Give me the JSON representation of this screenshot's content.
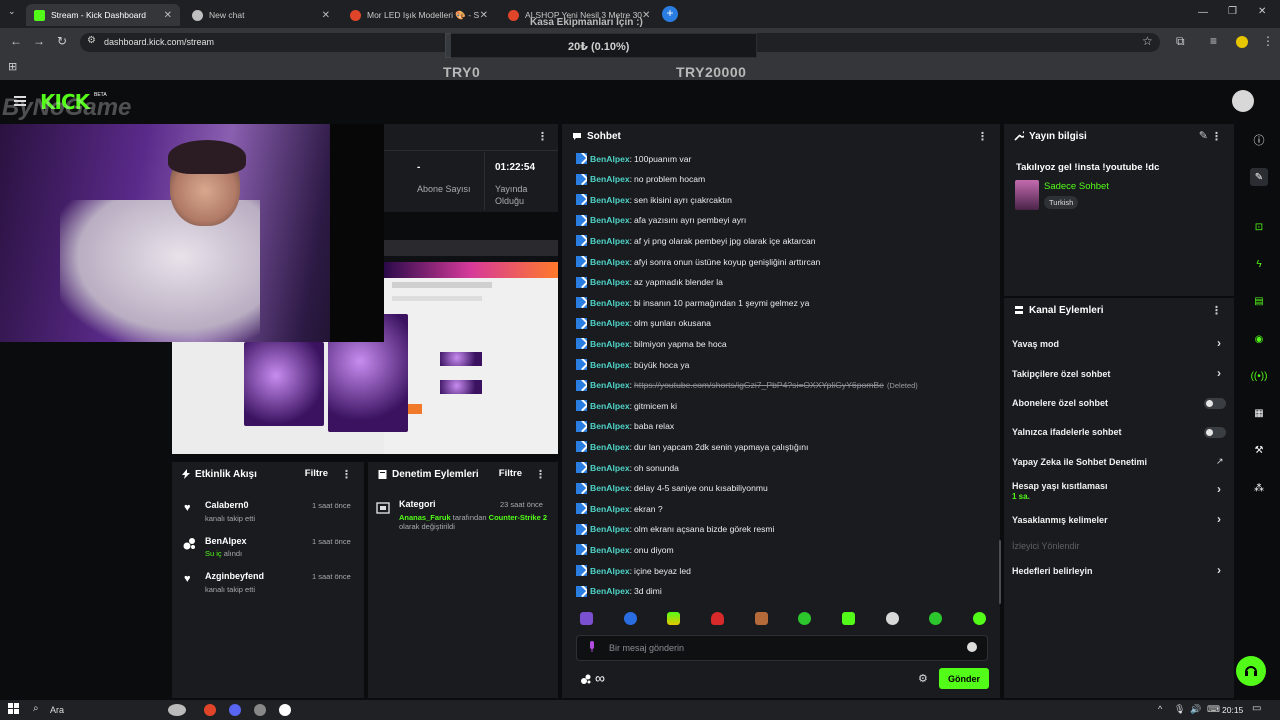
{
  "browser": {
    "tabs": [
      {
        "label": "Stream - Kick Dashboard",
        "active": true,
        "favicon_color": "#53fc18"
      },
      {
        "label": "New chat",
        "active": false,
        "favicon_color": "#bfbfbf"
      },
      {
        "label": "Mor LED Işık Modelleri 🎨 - S",
        "active": false,
        "favicon_color": "#e0452a"
      },
      {
        "label": "ALSHOP Yeni Nesil 3 Metre 30",
        "active": false,
        "favicon_color": "#e0452a"
      }
    ],
    "url": "dashboard.kick.com/stream"
  },
  "overlay": {
    "goal_title": "Kasa Ekipmanları İçin :)",
    "goal_value": "20₺ (0.10%)",
    "goal_progress": 0.001,
    "goal_min": "TRY0",
    "goal_max": "TRY20000",
    "watermark": "ByNoGame"
  },
  "kick": {
    "logo": "KICK",
    "beta": "BETA"
  },
  "stats": {
    "subs_value": "-",
    "subs_label": "Abone Sayısı",
    "uptime_value": "01:22:54",
    "uptime_label": "Yayında Olduğu"
  },
  "chat": {
    "title": "Sohbet",
    "messages": [
      {
        "user": "BenAlpex",
        "text": "100puanım var"
      },
      {
        "user": "BenAlpex",
        "text": "no problem hocam"
      },
      {
        "user": "BenAlpex",
        "text": "sen ikisini ayrı çıakrcaktın"
      },
      {
        "user": "BenAlpex",
        "text": "afa yazısını ayrı pembeyi ayrı"
      },
      {
        "user": "BenAlpex",
        "text": "af yi png olarak pembeyi jpg olarak içe aktarcan"
      },
      {
        "user": "BenAlpex",
        "text": "afyi sonra onun üstüne koyup genişliğini arttırcan"
      },
      {
        "user": "BenAlpex",
        "text": "az yapmadık blender la"
      },
      {
        "user": "BenAlpex",
        "text": "bi insanın 10 parmağından 1 şeymi gelmez ya"
      },
      {
        "user": "BenAlpex",
        "text": "olm şunları okusana"
      },
      {
        "user": "BenAlpex",
        "text": "bilmiyon yapma be hoca"
      },
      {
        "user": "BenAlpex",
        "text": "büyük hoca ya"
      },
      {
        "user": "BenAlpex",
        "text": "https://youtube.com/shorts/igGzi7_PbP4?si=OXXYpliGyY6pomBe",
        "deleted": "(Deleted)"
      },
      {
        "user": "BenAlpex",
        "text": "gitmicem ki"
      },
      {
        "user": "BenAlpex",
        "text": "baba relax"
      },
      {
        "user": "BenAlpex",
        "text": "dur lan yapcam 2dk senin yapmaya çalıştığını"
      },
      {
        "user": "BenAlpex",
        "text": "oh sonunda"
      },
      {
        "user": "BenAlpex",
        "text": "delay 4-5 saniye onu kısabiliyonmu"
      },
      {
        "user": "BenAlpex",
        "text": "ekran ?"
      },
      {
        "user": "BenAlpex",
        "text": "olm ekranı açsana bizde görek resmi"
      },
      {
        "user": "BenAlpex",
        "text": "onu diyom"
      },
      {
        "user": "BenAlpex",
        "text": "içine beyaz led"
      },
      {
        "user": "BenAlpex",
        "text": "3d dimi"
      }
    ],
    "input_placeholder": "Bir mesaj gönderin",
    "send_label": "Gönder",
    "infinity": "∞"
  },
  "info": {
    "title": "Yayın bilgisi",
    "stream_title": "Takılıyoz gel !insta !youtube !dc",
    "category": "Sadece Sohbet",
    "language": "Turkish"
  },
  "actions": {
    "title": "Kanal Eylemleri",
    "items": [
      {
        "label": "Yavaş mod",
        "control": "chevron"
      },
      {
        "label": "Takipçilere özel sohbet",
        "control": "chevron"
      },
      {
        "label": "Abonelere özel sohbet",
        "control": "toggle",
        "on": false
      },
      {
        "label": "Yalnızca ifadelerle sohbet",
        "control": "toggle",
        "on": false
      },
      {
        "label": "Yapay Zeka ile Sohbet Denetimi",
        "control": "external"
      },
      {
        "label": "Hesap yaşı kısıtlaması",
        "sub": "1 sa.",
        "control": "chevron"
      },
      {
        "label": "Yasaklanmış kelimeler",
        "control": "chevron"
      },
      {
        "label": "İzleyici Yönlendir",
        "control": "none",
        "disabled": true
      },
      {
        "label": "Hedefleri belirleyin",
        "control": "chevron"
      }
    ]
  },
  "activity": {
    "title": "Etkinlik Akışı",
    "filter": "Filtre",
    "items": [
      {
        "name": "Calabern0",
        "desc": "kanalı takip etti",
        "time": "1 saat önce",
        "icon": "heart-icon"
      },
      {
        "name": "BenAlpex",
        "desc_highlight": "Su iç",
        "desc": "alındı",
        "time": "1 saat önce",
        "icon": "points-icon"
      },
      {
        "name": "Azginbeyfend",
        "desc": "kanalı takip etti",
        "time": "1 saat önce",
        "icon": "heart-icon"
      }
    ]
  },
  "modlog": {
    "title": "Denetim Eylemleri",
    "filter": "Filtre",
    "item": {
      "name": "Kategori",
      "time": "23 saat önce",
      "actor": "Ananas_Faruk",
      "mid": "tarafından",
      "target": "Counter-Strike 2",
      "tail": "olarak değiştirildi"
    }
  },
  "taskbar": {
    "search": "Ara",
    "clock": "20:15"
  },
  "colors": {
    "accent": "#53fc18",
    "username": "#4fd3c7",
    "panel": "#191b1f",
    "background": "#0b0c0e"
  }
}
